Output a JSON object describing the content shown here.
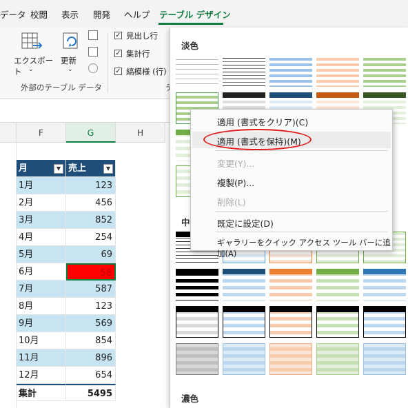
{
  "tabs": [
    "データ",
    "校閲",
    "表示",
    "開発",
    "ヘルプ",
    "テーブル デザイン"
  ],
  "ribbon": {
    "export_label": "エクスポート",
    "refresh_label": "更新",
    "group_external": "外部のテーブル データ",
    "opt_header_row": "見出し行",
    "opt_total_row": "集計行",
    "opt_banded_rows": "縞模様 (行)",
    "group_style_options_partial": "テ"
  },
  "columns": [
    "F",
    "G",
    "H"
  ],
  "table": {
    "headers": [
      "月",
      "売上"
    ],
    "rows": [
      {
        "month": "1月",
        "sales": "123"
      },
      {
        "month": "2月",
        "sales": "456"
      },
      {
        "month": "3月",
        "sales": "852"
      },
      {
        "month": "4月",
        "sales": "254"
      },
      {
        "month": "5月",
        "sales": "69"
      },
      {
        "month": "6月",
        "sales": "58"
      },
      {
        "month": "7月",
        "sales": "587"
      },
      {
        "month": "8月",
        "sales": "123"
      },
      {
        "month": "9月",
        "sales": "569"
      },
      {
        "month": "10月",
        "sales": "854"
      },
      {
        "month": "11月",
        "sales": "896"
      },
      {
        "month": "12月",
        "sales": "654"
      }
    ],
    "total_label": "集計",
    "total_value": "5495",
    "selected_cell_color": "#ff0000",
    "header_color": "#1f4e78",
    "band_color": "#c7e4f3"
  },
  "gallery": {
    "light_label": "淡色",
    "medium_label_partial": "中",
    "dark_label": "濃色"
  },
  "context_menu": {
    "items": [
      {
        "label": "適用 (書式をクリア)(C)",
        "enabled": true
      },
      {
        "label": "適用 (書式を保持)(M)",
        "enabled": true
      },
      {
        "label": "変更(Y)...",
        "enabled": false
      },
      {
        "label": "複製(P)...",
        "enabled": true
      },
      {
        "label": "削除(L)",
        "enabled": false
      },
      {
        "label": "既定に設定(D)",
        "enabled": true
      },
      {
        "label": "ギャラリーをクイック アクセス ツール バーに追加(A)",
        "enabled": true
      }
    ]
  }
}
